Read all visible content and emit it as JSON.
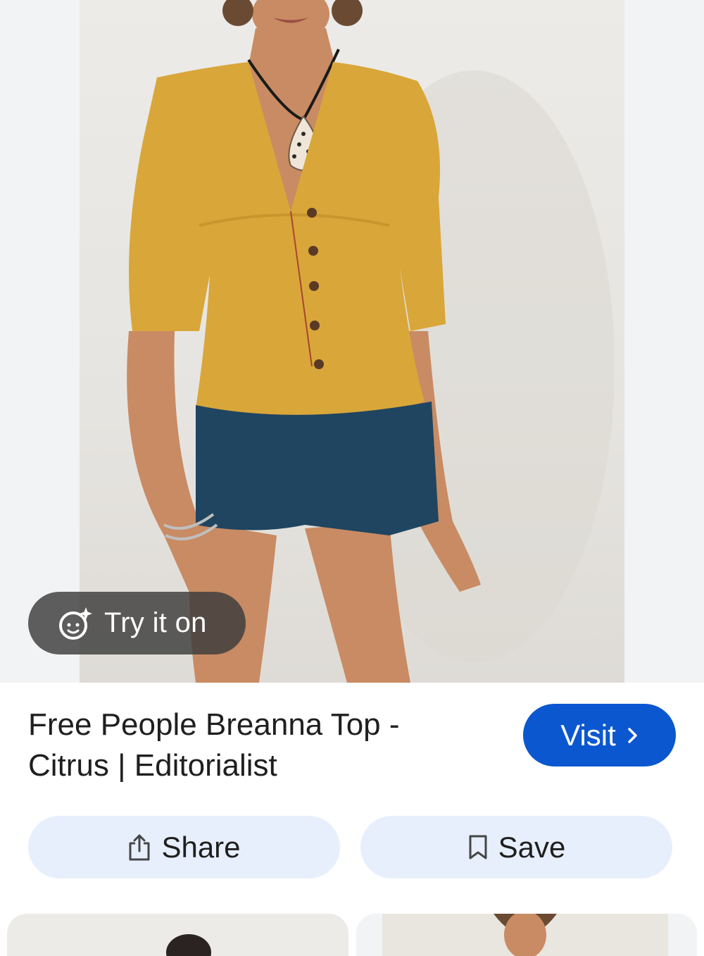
{
  "result": {
    "title": "Free People Breanna Top - Citrus | Editorialist"
  },
  "try_on": {
    "label": "Try it on",
    "icon": "face-sparkle-icon"
  },
  "actions": {
    "visit_label": "Visit",
    "share_label": "Share",
    "save_label": "Save"
  },
  "colors": {
    "accent": "#0b57d0",
    "tonal_button": "#e8effc",
    "pill_overlay": "#3c3c3c"
  }
}
